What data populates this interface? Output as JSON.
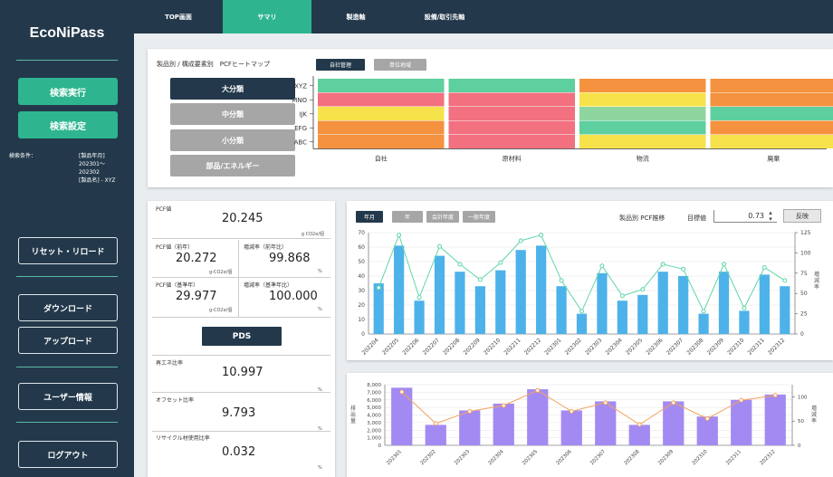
{
  "app": {
    "name": "EcoNiPass"
  },
  "sidebar": {
    "search_exec": "検索実行",
    "search_settings": "検索設定",
    "cond_label": "検索条件：",
    "cond_value": "[製品年月]\n202301～\n202302\n[製品名] - XYZ",
    "reset": "リセット・リロード",
    "download": "ダウンロード",
    "upload": "アップロード",
    "user_info": "ユーザー情報",
    "logout": "ログアウト"
  },
  "nav": {
    "tabs": [
      "TOP画面",
      "サマリ",
      "製造軸",
      "設備/取引先軸"
    ],
    "active": 1
  },
  "heatmap": {
    "title": "製品別 / 構成要素別　PCFヒートマップ",
    "toggle": [
      "自社管理",
      "単位地域"
    ],
    "category_buttons": [
      "大分類",
      "中分類",
      "小分類",
      "部品/エネルギー"
    ],
    "active_button": 0,
    "rows": [
      "XYZ",
      "MNO",
      "IJK",
      "EFG",
      "ABC"
    ],
    "columns": [
      "自社",
      "原材料",
      "物流",
      "廃棄"
    ],
    "colors": {
      "red": "#f2707f",
      "orange": "#f4923f",
      "yellow": "#f6e24a",
      "green": "#5ecf9e",
      "lgreen": "#8ed5a0"
    },
    "cells": [
      [
        "green",
        "green",
        "orange",
        "orange"
      ],
      [
        "red",
        "red",
        "yellow",
        "orange"
      ],
      [
        "yellow",
        "red",
        "lgreen",
        "green"
      ],
      [
        "orange",
        "red",
        "green",
        "orange"
      ],
      [
        "orange",
        "red",
        "yellow",
        "yellow"
      ]
    ]
  },
  "kpi": {
    "pcf_label": "PCF値",
    "pcf_value": "20.245",
    "pcf_unit": "g CO2e/個",
    "prev_label": "PCF値（前年）",
    "prev_value": "20.272",
    "prev_unit": "g-CO2e/個",
    "rate_prev_label": "増減率（前年比）",
    "rate_prev_value": "99.868",
    "pct": "%",
    "base_label": "PCF値（基準年）",
    "base_value": "29.977",
    "base_unit": "g-CO2e/個",
    "rate_base_label": "増減率（基準年比）",
    "rate_base_value": "100.000",
    "pds_button": "PDS",
    "renew_label": "再エネ比率",
    "renew_value": "10.997",
    "offset_label": "オフセット比率",
    "offset_value": "9.793",
    "recycle_label": "リサイクル材使用比率",
    "recycle_value": "0.032"
  },
  "trend": {
    "period_tabs": [
      "年月",
      "年",
      "会計年度",
      "一般年度"
    ],
    "active_tab": 0,
    "label": "製品別 PCF推移",
    "target_label": "目標値",
    "target_value": "0.73",
    "apply": "反映",
    "y2label": "増減率"
  },
  "bottom": {
    "ylabel": "排出量",
    "y2label": "増減率"
  },
  "chart_data": [
    {
      "type": "bar+line",
      "categories": [
        "202204",
        "202205",
        "202206",
        "202207",
        "202208",
        "202209",
        "202210",
        "202211",
        "202212",
        "202301",
        "202302",
        "202303",
        "202304",
        "202305",
        "202306",
        "202307",
        "202308",
        "202309",
        "202310",
        "202311",
        "202312"
      ],
      "series": [
        {
          "type": "bar",
          "values": [
            35,
            61,
            23,
            54,
            43,
            33,
            44,
            58,
            61,
            33,
            14,
            42,
            23,
            27,
            43,
            40,
            14,
            43,
            16,
            41,
            33
          ]
        },
        {
          "type": "line",
          "values": [
            57,
            122,
            45,
            108,
            86,
            67,
            88,
            115,
            122,
            66,
            28,
            84,
            47,
            55,
            86,
            80,
            28,
            86,
            32,
            82,
            66
          ]
        }
      ],
      "ylim": [
        0,
        70
      ],
      "y2lim": [
        0,
        125
      ],
      "yticks": [
        0,
        10,
        20,
        30,
        40,
        50,
        60,
        70
      ],
      "y2ticks": [
        0,
        25,
        50,
        75,
        100,
        125
      ],
      "colors": {
        "bar": "#4db2e9",
        "line": "#5fd6a8"
      }
    },
    {
      "type": "bar+line",
      "categories": [
        "202301",
        "202302",
        "202303",
        "202304",
        "202305",
        "202306",
        "202307",
        "202308",
        "202309",
        "202310",
        "202311",
        "202312"
      ],
      "series": [
        {
          "type": "bar",
          "values": [
            7600,
            2700,
            4600,
            5500,
            7400,
            4600,
            5800,
            2700,
            5800,
            3800,
            6000,
            6700
          ]
        },
        {
          "type": "line",
          "values": [
            110,
            45,
            70,
            82,
            113,
            70,
            88,
            43,
            88,
            55,
            93,
            103
          ]
        }
      ],
      "ylim": [
        0,
        8000
      ],
      "y2lim": [
        0,
        125
      ],
      "yticks": [
        "0",
        "1,000",
        "2,000",
        "3,000",
        "4,000",
        "5,000",
        "6,000",
        "7,000",
        "8,000"
      ],
      "y2ticks": [
        0,
        50,
        100
      ],
      "colors": {
        "bar": "#a38af2",
        "line": "#f2a35c"
      }
    }
  ]
}
